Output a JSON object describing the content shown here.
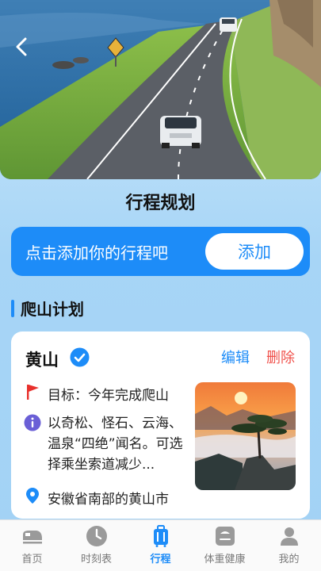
{
  "page": {
    "title": "行程规划"
  },
  "banner": {
    "prompt": "点击添加你的行程吧",
    "add_label": "添加"
  },
  "section": {
    "title": "爬山计划"
  },
  "trip_card": {
    "name": "黄山",
    "edit_label": "编辑",
    "delete_label": "删除",
    "goal": "目标：今年完成爬山",
    "description": "以奇松、怪石、云海、温泉“四绝”闻名。可选择乘坐索道减少...",
    "location": "安徽省南部的黄山市"
  },
  "bottom_nav": {
    "items": [
      {
        "label": "首页",
        "icon": "train-icon",
        "active": false
      },
      {
        "label": "时刻表",
        "icon": "clock-icon",
        "active": false
      },
      {
        "label": "行程",
        "icon": "luggage-icon",
        "active": true
      },
      {
        "label": "体重健康",
        "icon": "scale-icon",
        "active": false
      },
      {
        "label": "我的",
        "icon": "user-icon",
        "active": false
      }
    ]
  },
  "colors": {
    "accent": "#1d8cf8",
    "danger": "#f0524c",
    "background": "#a7d5f6"
  }
}
